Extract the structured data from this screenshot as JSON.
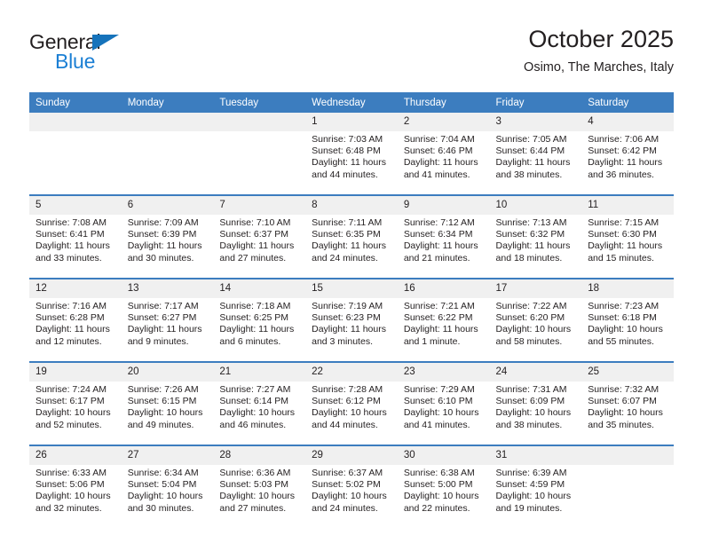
{
  "brand": {
    "name_part1": "General",
    "name_part2": "Blue",
    "color_dark": "#231f20",
    "color_blue": "#1b7fd4"
  },
  "header": {
    "title": "October 2025",
    "subtitle": "Osimo, The Marches, Italy"
  },
  "theme": {
    "header_bg": "#3c7dbf",
    "header_text": "#ffffff",
    "daynum_bg": "#f0f0f0",
    "cell_bg": "#ffffff",
    "text": "#231f20"
  },
  "weekday_headers": [
    "Sunday",
    "Monday",
    "Tuesday",
    "Wednesday",
    "Thursday",
    "Friday",
    "Saturday"
  ],
  "weeks": [
    [
      {
        "day": "",
        "lines": []
      },
      {
        "day": "",
        "lines": []
      },
      {
        "day": "",
        "lines": []
      },
      {
        "day": "1",
        "lines": [
          "Sunrise: 7:03 AM",
          "Sunset: 6:48 PM",
          "Daylight: 11 hours",
          "and 44 minutes."
        ]
      },
      {
        "day": "2",
        "lines": [
          "Sunrise: 7:04 AM",
          "Sunset: 6:46 PM",
          "Daylight: 11 hours",
          "and 41 minutes."
        ]
      },
      {
        "day": "3",
        "lines": [
          "Sunrise: 7:05 AM",
          "Sunset: 6:44 PM",
          "Daylight: 11 hours",
          "and 38 minutes."
        ]
      },
      {
        "day": "4",
        "lines": [
          "Sunrise: 7:06 AM",
          "Sunset: 6:42 PM",
          "Daylight: 11 hours",
          "and 36 minutes."
        ]
      }
    ],
    [
      {
        "day": "5",
        "lines": [
          "Sunrise: 7:08 AM",
          "Sunset: 6:41 PM",
          "Daylight: 11 hours",
          "and 33 minutes."
        ]
      },
      {
        "day": "6",
        "lines": [
          "Sunrise: 7:09 AM",
          "Sunset: 6:39 PM",
          "Daylight: 11 hours",
          "and 30 minutes."
        ]
      },
      {
        "day": "7",
        "lines": [
          "Sunrise: 7:10 AM",
          "Sunset: 6:37 PM",
          "Daylight: 11 hours",
          "and 27 minutes."
        ]
      },
      {
        "day": "8",
        "lines": [
          "Sunrise: 7:11 AM",
          "Sunset: 6:35 PM",
          "Daylight: 11 hours",
          "and 24 minutes."
        ]
      },
      {
        "day": "9",
        "lines": [
          "Sunrise: 7:12 AM",
          "Sunset: 6:34 PM",
          "Daylight: 11 hours",
          "and 21 minutes."
        ]
      },
      {
        "day": "10",
        "lines": [
          "Sunrise: 7:13 AM",
          "Sunset: 6:32 PM",
          "Daylight: 11 hours",
          "and 18 minutes."
        ]
      },
      {
        "day": "11",
        "lines": [
          "Sunrise: 7:15 AM",
          "Sunset: 6:30 PM",
          "Daylight: 11 hours",
          "and 15 minutes."
        ]
      }
    ],
    [
      {
        "day": "12",
        "lines": [
          "Sunrise: 7:16 AM",
          "Sunset: 6:28 PM",
          "Daylight: 11 hours",
          "and 12 minutes."
        ]
      },
      {
        "day": "13",
        "lines": [
          "Sunrise: 7:17 AM",
          "Sunset: 6:27 PM",
          "Daylight: 11 hours",
          "and 9 minutes."
        ]
      },
      {
        "day": "14",
        "lines": [
          "Sunrise: 7:18 AM",
          "Sunset: 6:25 PM",
          "Daylight: 11 hours",
          "and 6 minutes."
        ]
      },
      {
        "day": "15",
        "lines": [
          "Sunrise: 7:19 AM",
          "Sunset: 6:23 PM",
          "Daylight: 11 hours",
          "and 3 minutes."
        ]
      },
      {
        "day": "16",
        "lines": [
          "Sunrise: 7:21 AM",
          "Sunset: 6:22 PM",
          "Daylight: 11 hours",
          "and 1 minute."
        ]
      },
      {
        "day": "17",
        "lines": [
          "Sunrise: 7:22 AM",
          "Sunset: 6:20 PM",
          "Daylight: 10 hours",
          "and 58 minutes."
        ]
      },
      {
        "day": "18",
        "lines": [
          "Sunrise: 7:23 AM",
          "Sunset: 6:18 PM",
          "Daylight: 10 hours",
          "and 55 minutes."
        ]
      }
    ],
    [
      {
        "day": "19",
        "lines": [
          "Sunrise: 7:24 AM",
          "Sunset: 6:17 PM",
          "Daylight: 10 hours",
          "and 52 minutes."
        ]
      },
      {
        "day": "20",
        "lines": [
          "Sunrise: 7:26 AM",
          "Sunset: 6:15 PM",
          "Daylight: 10 hours",
          "and 49 minutes."
        ]
      },
      {
        "day": "21",
        "lines": [
          "Sunrise: 7:27 AM",
          "Sunset: 6:14 PM",
          "Daylight: 10 hours",
          "and 46 minutes."
        ]
      },
      {
        "day": "22",
        "lines": [
          "Sunrise: 7:28 AM",
          "Sunset: 6:12 PM",
          "Daylight: 10 hours",
          "and 44 minutes."
        ]
      },
      {
        "day": "23",
        "lines": [
          "Sunrise: 7:29 AM",
          "Sunset: 6:10 PM",
          "Daylight: 10 hours",
          "and 41 minutes."
        ]
      },
      {
        "day": "24",
        "lines": [
          "Sunrise: 7:31 AM",
          "Sunset: 6:09 PM",
          "Daylight: 10 hours",
          "and 38 minutes."
        ]
      },
      {
        "day": "25",
        "lines": [
          "Sunrise: 7:32 AM",
          "Sunset: 6:07 PM",
          "Daylight: 10 hours",
          "and 35 minutes."
        ]
      }
    ],
    [
      {
        "day": "26",
        "lines": [
          "Sunrise: 6:33 AM",
          "Sunset: 5:06 PM",
          "Daylight: 10 hours",
          "and 32 minutes."
        ]
      },
      {
        "day": "27",
        "lines": [
          "Sunrise: 6:34 AM",
          "Sunset: 5:04 PM",
          "Daylight: 10 hours",
          "and 30 minutes."
        ]
      },
      {
        "day": "28",
        "lines": [
          "Sunrise: 6:36 AM",
          "Sunset: 5:03 PM",
          "Daylight: 10 hours",
          "and 27 minutes."
        ]
      },
      {
        "day": "29",
        "lines": [
          "Sunrise: 6:37 AM",
          "Sunset: 5:02 PM",
          "Daylight: 10 hours",
          "and 24 minutes."
        ]
      },
      {
        "day": "30",
        "lines": [
          "Sunrise: 6:38 AM",
          "Sunset: 5:00 PM",
          "Daylight: 10 hours",
          "and 22 minutes."
        ]
      },
      {
        "day": "31",
        "lines": [
          "Sunrise: 6:39 AM",
          "Sunset: 4:59 PM",
          "Daylight: 10 hours",
          "and 19 minutes."
        ]
      },
      {
        "day": "",
        "lines": []
      }
    ]
  ]
}
